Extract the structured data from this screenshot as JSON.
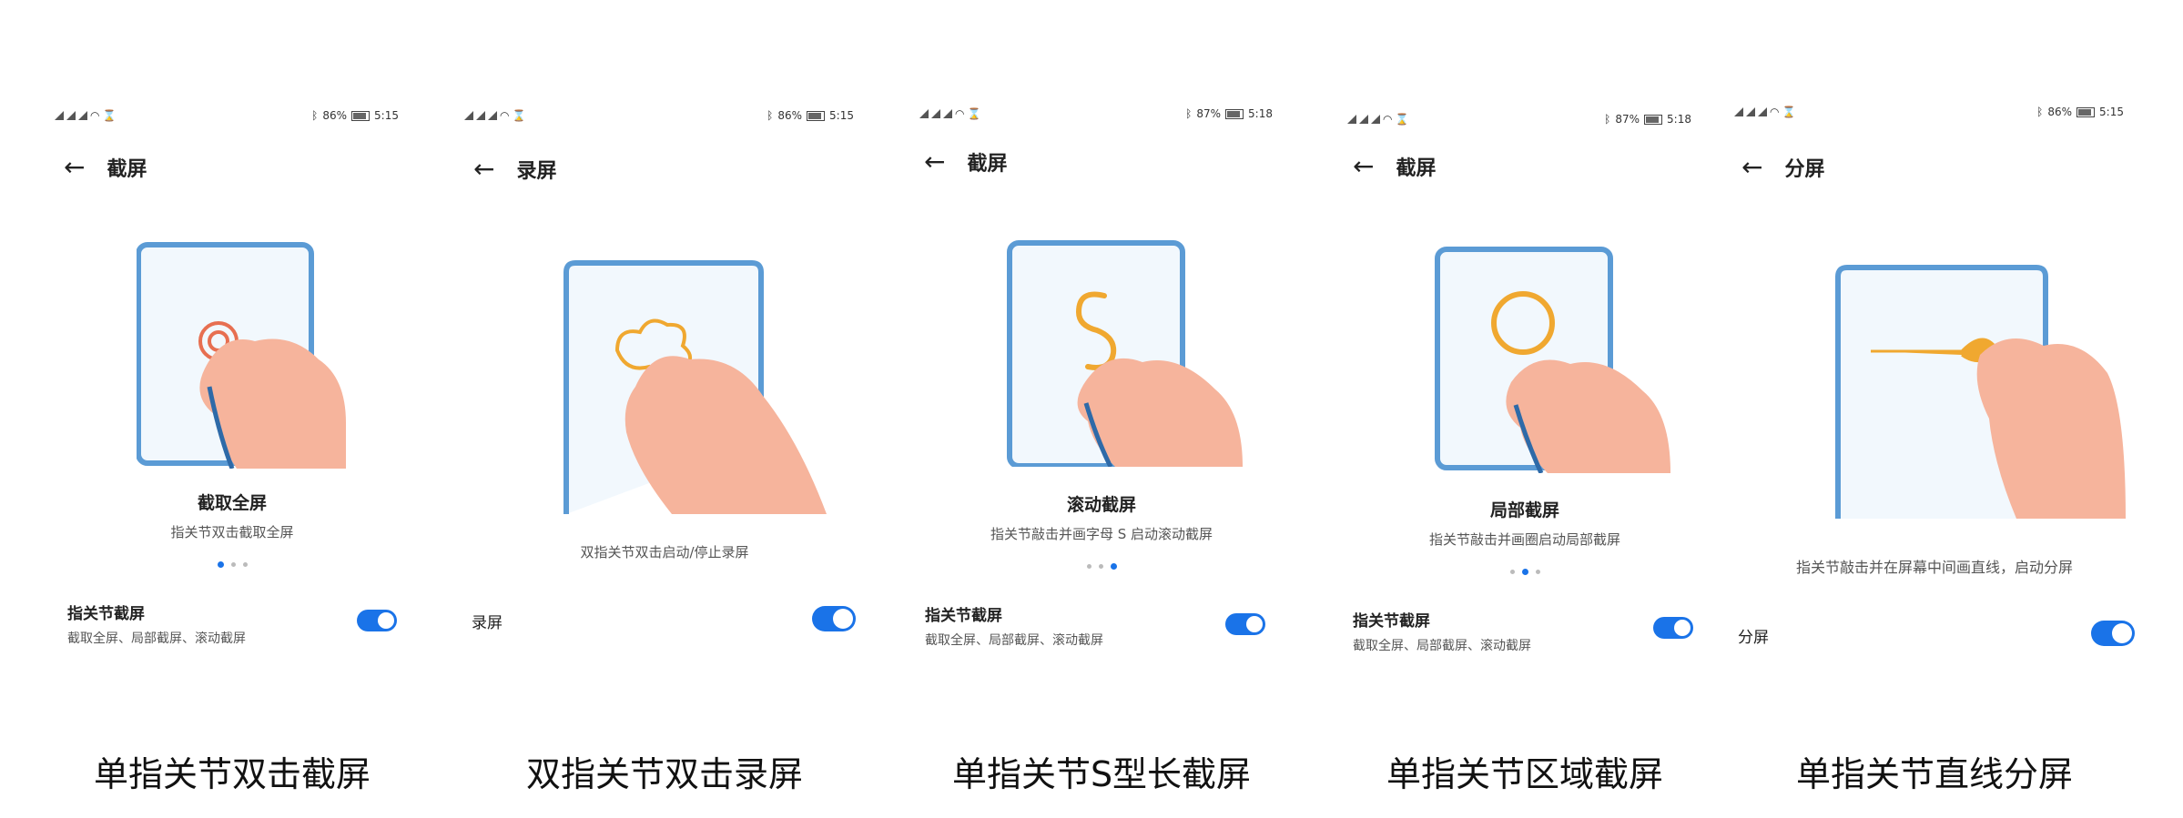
{
  "panels": [
    {
      "status": {
        "battery": "86%",
        "time": "5:15"
      },
      "header_title": "截屏",
      "caption": "截取全屏",
      "description": "指关节双击截取全屏",
      "dots": 3,
      "active_dot": 0,
      "setting_title": "指关节截屏",
      "setting_sub": "截取全屏、局部截屏、滚动截屏",
      "toggle_on": true,
      "bottom_label": "单指关节双击截屏"
    },
    {
      "status": {
        "battery": "86%",
        "time": "5:15"
      },
      "header_title": "录屏",
      "caption": "",
      "description": "双指关节双击启动/停止录屏",
      "dots": 0,
      "active_dot": -1,
      "setting_title": "录屏",
      "setting_sub": "",
      "toggle_on": true,
      "bottom_label": "双指关节双击录屏"
    },
    {
      "status": {
        "battery": "87%",
        "time": "5:18"
      },
      "header_title": "截屏",
      "caption": "滚动截屏",
      "description": "指关节敲击并画字母 S 启动滚动截屏",
      "dots": 3,
      "active_dot": 2,
      "setting_title": "指关节截屏",
      "setting_sub": "截取全屏、局部截屏、滚动截屏",
      "toggle_on": true,
      "bottom_label": "单指关节S型长截屏"
    },
    {
      "status": {
        "battery": "87%",
        "time": "5:18"
      },
      "header_title": "截屏",
      "caption": "局部截屏",
      "description": "指关节敲击并画圈启动局部截屏",
      "dots": 3,
      "active_dot": 1,
      "setting_title": "指关节截屏",
      "setting_sub": "截取全屏、局部截屏、滚动截屏",
      "toggle_on": true,
      "bottom_label": "单指关节区域截屏"
    },
    {
      "status": {
        "battery": "86%",
        "time": "5:15"
      },
      "header_title": "分屏",
      "caption": "",
      "description": "指关节敲击并在屏幕中间画直线，启动分屏",
      "dots": 0,
      "active_dot": -1,
      "setting_title": "分屏",
      "setting_sub": "",
      "toggle_on": true,
      "bottom_label": "单指关节直线分屏"
    }
  ],
  "colors": {
    "accent": "#1a73e8",
    "frame": "#5b9bd5",
    "hand": "#f6b49c",
    "gesture": "#f0a830",
    "text": "#222222"
  }
}
